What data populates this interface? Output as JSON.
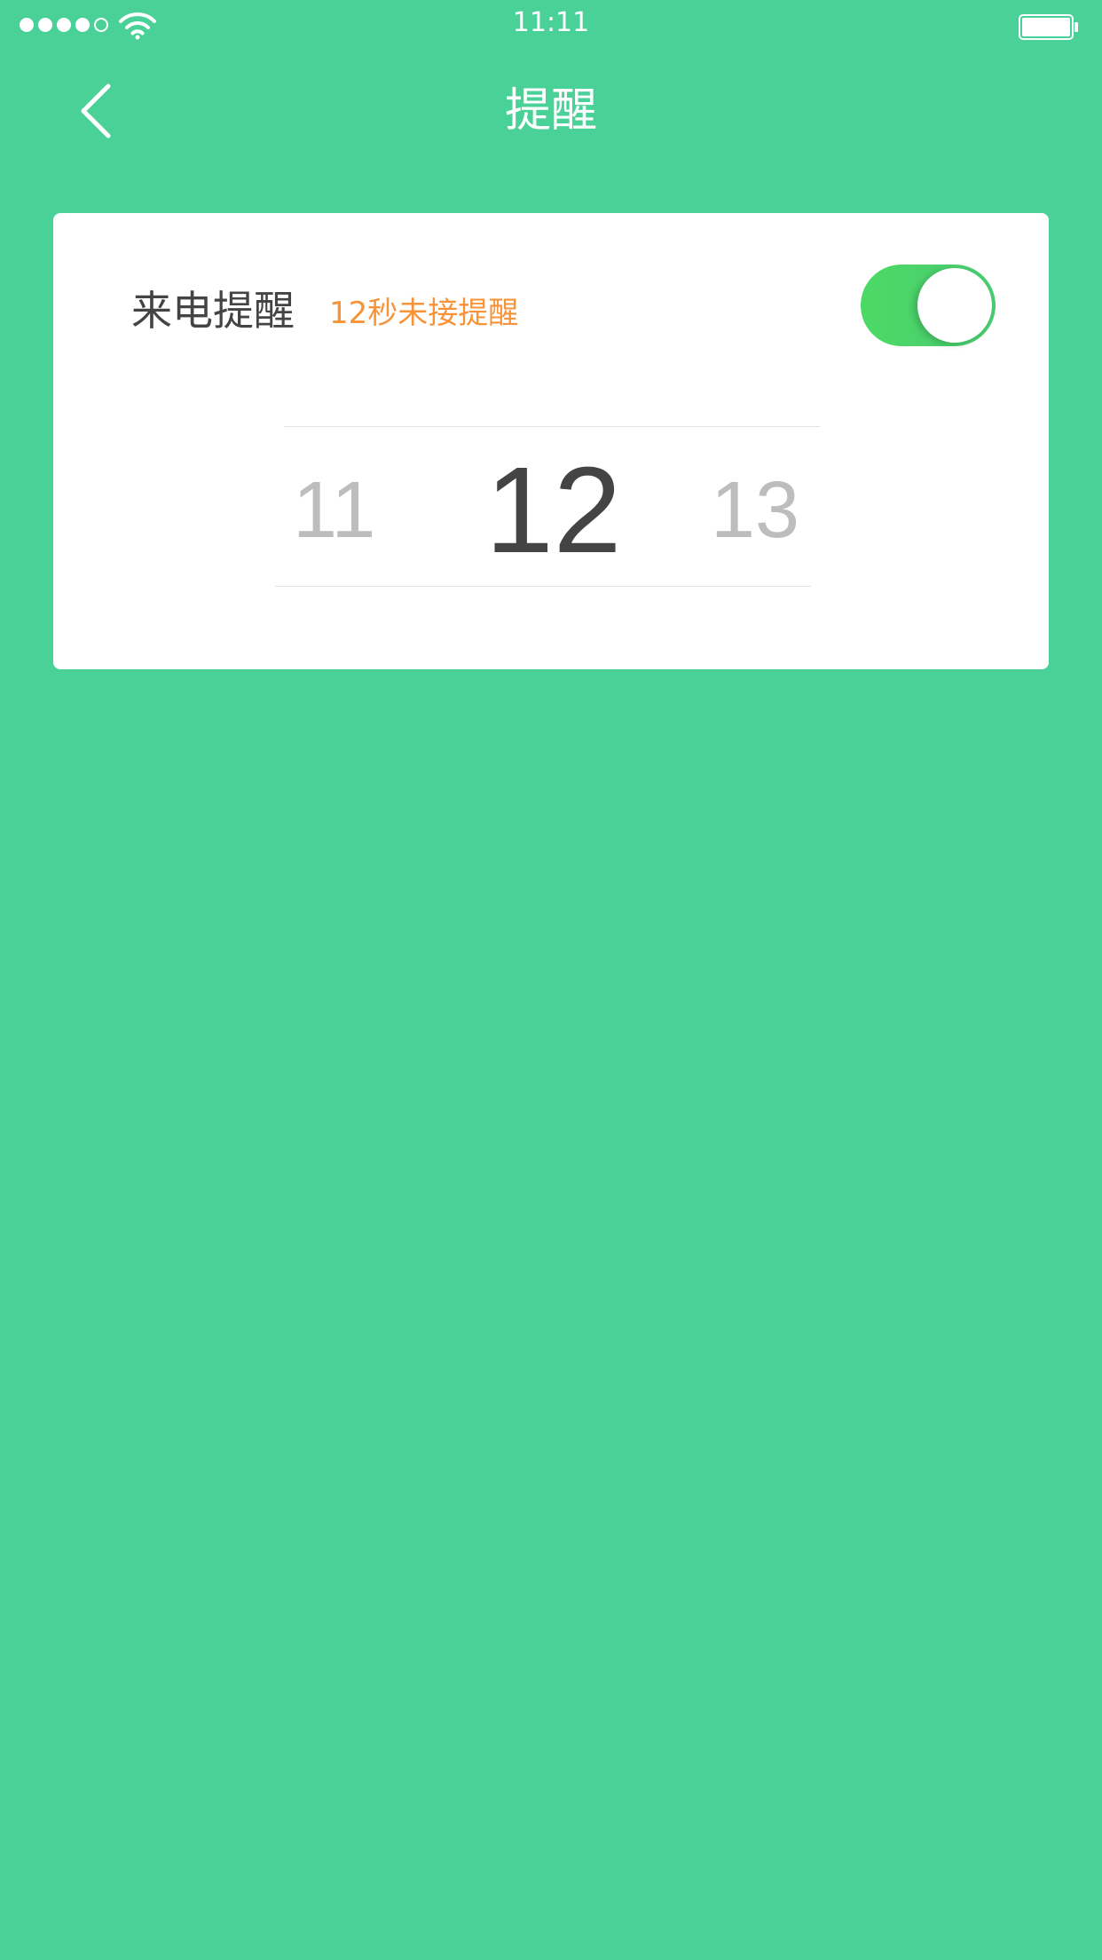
{
  "status_bar": {
    "time": "11:11",
    "signal_bars_filled": 4,
    "signal_bars_total": 5,
    "wifi_icon": "wifi-icon",
    "battery_icon": "battery-full-icon"
  },
  "nav": {
    "title": "提醒",
    "back_icon": "chevron-left-icon"
  },
  "reminder": {
    "label": "来电提醒",
    "subtitle": "12秒未接提醒",
    "toggle_on": true,
    "toggle_color": "#4CD964"
  },
  "picker": {
    "prev": "11",
    "selected": "12",
    "next": "13"
  },
  "colors": {
    "background": "#4AD198",
    "accent_orange": "#F7943A",
    "text_dark": "#444444",
    "text_muted": "#BDBDBD"
  }
}
